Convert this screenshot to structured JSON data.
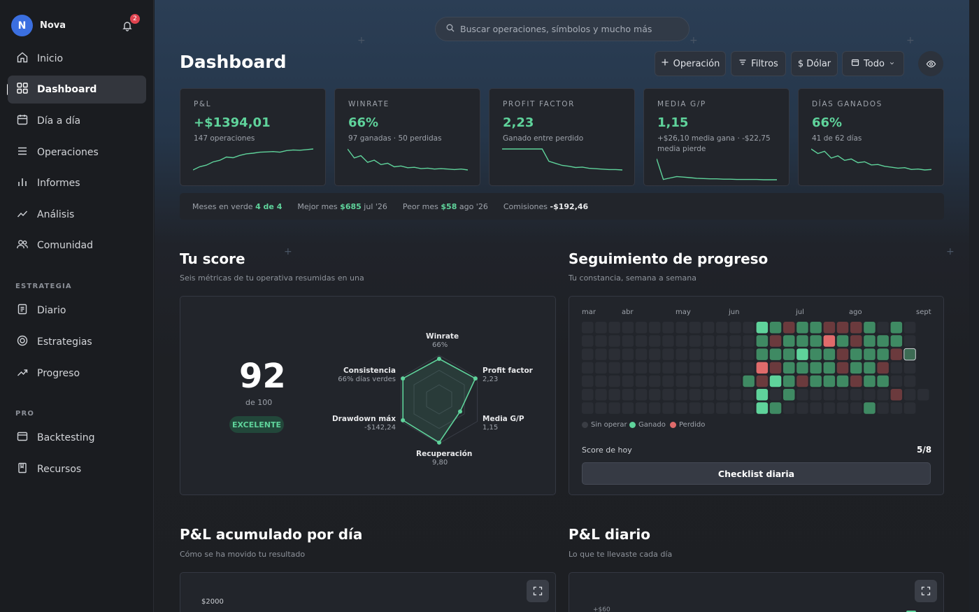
{
  "user": {
    "initial": "N",
    "name": "Nova",
    "notifications": "2"
  },
  "nav": [
    {
      "label": "Inicio",
      "icon": "home-icon"
    },
    {
      "label": "Dashboard",
      "icon": "grid-icon",
      "active": true
    },
    {
      "label": "Día a día",
      "icon": "calendar-icon"
    },
    {
      "label": "Operaciones",
      "icon": "list-icon"
    },
    {
      "label": "Informes",
      "icon": "bar-chart-icon"
    },
    {
      "label": "Análisis",
      "icon": "trend-icon"
    },
    {
      "label": "Comunidad",
      "icon": "users-icon"
    }
  ],
  "sections": {
    "estrategia": "ESTRATEGIA",
    "pro": "PRO"
  },
  "nav_estrategia": [
    {
      "label": "Diario",
      "icon": "notebook-icon"
    },
    {
      "label": "Estrategias",
      "icon": "target-icon"
    },
    {
      "label": "Progreso",
      "icon": "progress-icon"
    }
  ],
  "nav_pro": [
    {
      "label": "Backtesting",
      "icon": "window-icon"
    },
    {
      "label": "Recursos",
      "icon": "book-icon"
    }
  ],
  "search": {
    "placeholder": "Buscar operaciones, símbolos y mucho más"
  },
  "header": {
    "title": "Dashboard"
  },
  "toolbar": {
    "operation": "Operación",
    "filters": "Filtros",
    "currency": "$ Dólar",
    "period": "Todo"
  },
  "stats": [
    {
      "label": "P&L",
      "value": "+$1394,01",
      "sub": "147 operaciones",
      "spark": [
        2,
        3,
        3.5,
        4.5,
        5,
        6,
        5.8,
        6.5,
        7,
        7.2,
        7.5,
        7.6,
        7.7,
        7.5,
        8,
        8.2,
        8.1,
        8.3,
        8.5
      ]
    },
    {
      "label": "WINRATE",
      "value": "66%",
      "sub": "97 ganadas · 50 perdidas",
      "spark": [
        9,
        7,
        7.5,
        6,
        6.5,
        5.5,
        5.8,
        5,
        5.2,
        4.8,
        4.9,
        4.6,
        4.7,
        4.5,
        4.6,
        4.5,
        4.4,
        4.5,
        4.3
      ]
    },
    {
      "label": "PROFIT FACTOR",
      "value": "2,23",
      "sub": "Ganado entre perdido",
      "spark": [
        9,
        9,
        9,
        9,
        9,
        9,
        9,
        6,
        5.5,
        5,
        4.8,
        4.5,
        4.6,
        4.3,
        4.2,
        4.1,
        4,
        4,
        3.9
      ]
    },
    {
      "label": "MEDIA G/P",
      "value": "1,15",
      "sub": "+$26,10 media gana · -$22,75 media pierde",
      "spark": [
        9,
        2,
        2.5,
        3,
        2.8,
        2.6,
        2.4,
        2.3,
        2.2,
        2.2,
        2.1,
        2.1,
        2,
        2,
        2,
        2,
        1.9,
        1.9,
        1.9
      ]
    },
    {
      "label": "DÍAS GANADOS",
      "value": "66%",
      "sub": "41 de 62 días",
      "spark": [
        9,
        8,
        8.5,
        7,
        7.5,
        6.5,
        6.8,
        6,
        6.2,
        5.5,
        5.6,
        5.2,
        5,
        4.8,
        4.9,
        4.5,
        4.6,
        4.4,
        4.5
      ]
    }
  ],
  "summary": {
    "green_months_label": "Meses en verde",
    "green_months": "4 de 4",
    "best_label": "Mejor mes",
    "best_value": "$685",
    "best_month": "jul '26",
    "worst_label": "Peor mes",
    "worst_value": "$58",
    "worst_month": "ago '26",
    "fees_label": "Comisiones",
    "fees_value": "-$192,46"
  },
  "score": {
    "title": "Tu score",
    "subtitle": "Seis métricas de tu operativa resumidas en una",
    "value": "92",
    "of": "de 100",
    "badge": "EXCELENTE",
    "metrics": [
      {
        "name": "Winrate",
        "value": "66%",
        "level": 0.92
      },
      {
        "name": "Profit factor",
        "value": "2,23",
        "level": 0.95
      },
      {
        "name": "Media G/P",
        "value": "1,15",
        "level": 0.55
      },
      {
        "name": "Recuperación",
        "value": "9,80",
        "level": 0.98
      },
      {
        "name": "Drawdown máx",
        "value": "-$142,24",
        "level": 0.95
      },
      {
        "name": "Consistencia",
        "value": "66% días verdes",
        "level": 0.95
      }
    ]
  },
  "progress": {
    "title": "Seguimiento de progreso",
    "subtitle": "Tu constancia, semana a semana",
    "months": [
      "mar",
      "abr",
      "may",
      "jun",
      "jul",
      "ago",
      "sept"
    ],
    "legend": {
      "none": "Sin operar",
      "win": "Ganado",
      "loss": "Perdido"
    },
    "today_label": "Score de hoy",
    "today_value": "5/8",
    "checklist": "Checklist diaria",
    "heatmap_weeks_from": 13,
    "heatmap": [
      "0000000000000GGRGGRRRG0G0",
      "0000000000000GRGGGRGRGGG0",
      "0000000000000GGGGGGRGGGRT",
      "0000000000000RRGGGGRGGR00",
      "000000000000GRGGRGGGRGG00",
      "0000000000000G0G0000000R00",
      "0000000000000GG000000G000"
    ]
  },
  "pnl_cum": {
    "title": "P&L acumulado por día",
    "subtitle": "Cómo se ha movido tu resultado",
    "ytick": "$2000"
  },
  "pnl_daily": {
    "title": "P&L diario",
    "subtitle": "Lo que te llevaste cada día",
    "ytick": "+$60"
  },
  "colors": {
    "accent": "#5fd39b",
    "loss": "#e06b6b",
    "win_cell": "#3f8a63",
    "loss_cell": "#6b3a3d"
  }
}
